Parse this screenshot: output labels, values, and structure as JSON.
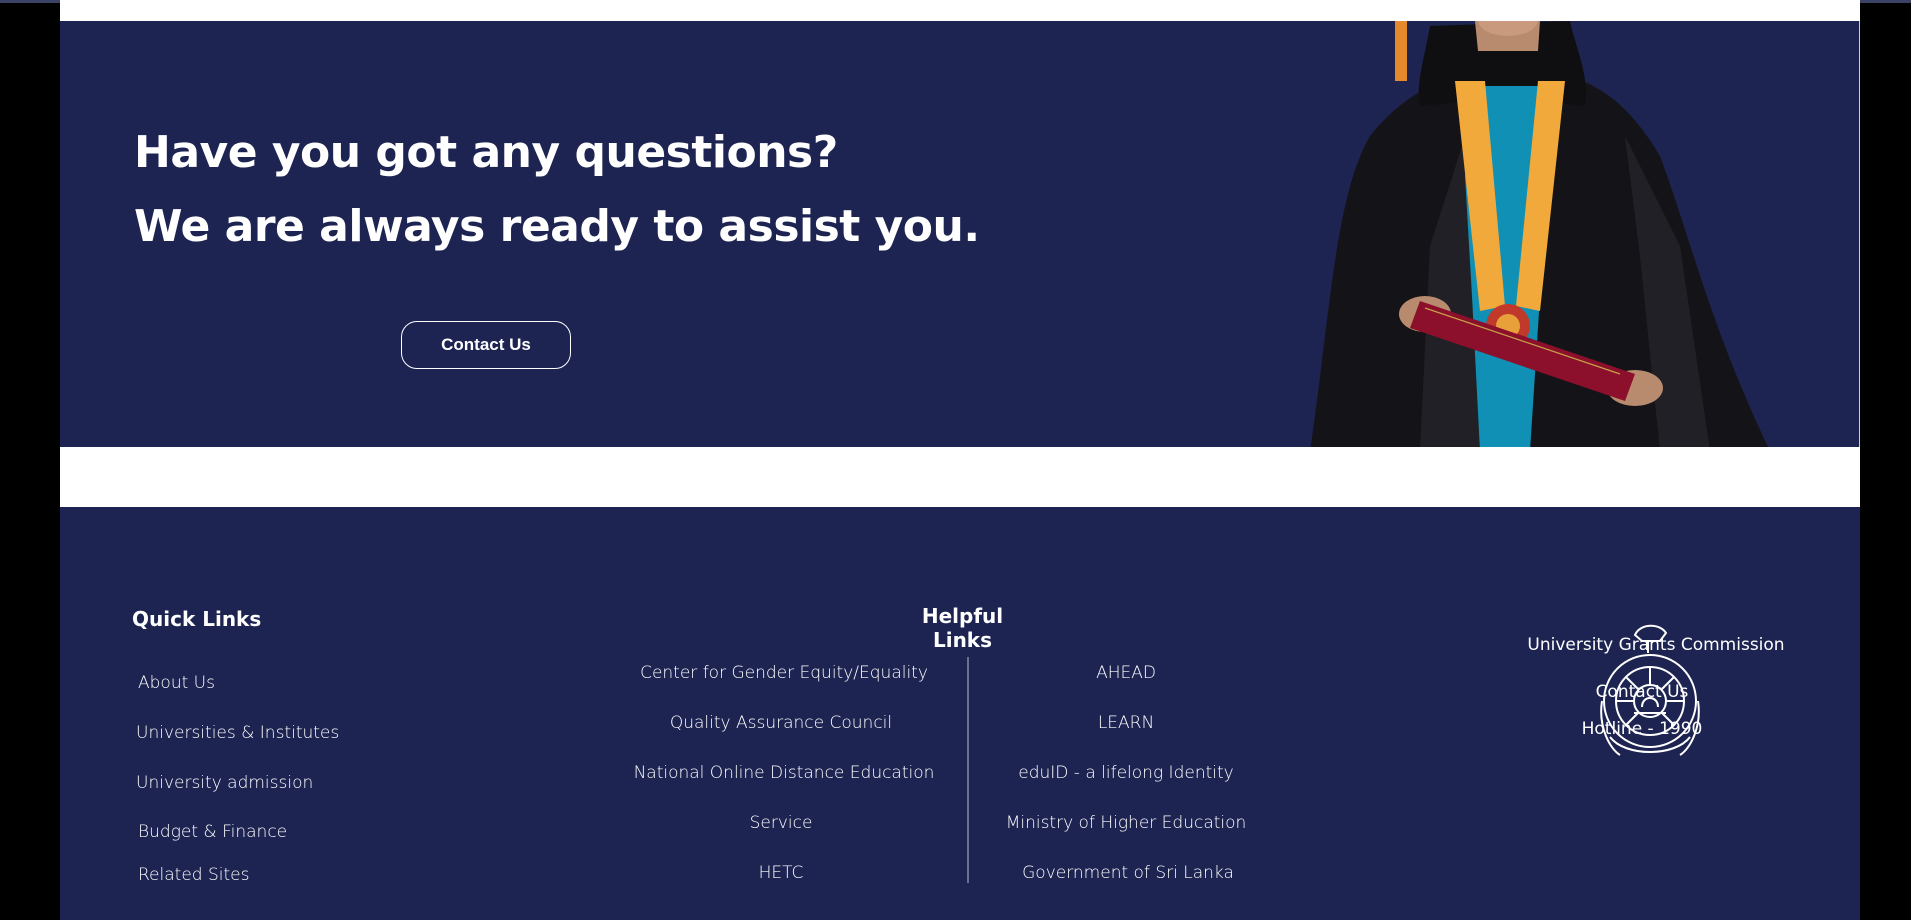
{
  "cta": {
    "heading_line1": "Have you got any questions?",
    "heading_line2": "We are always ready to assist you.",
    "contact_button": "Contact Us"
  },
  "footer": {
    "quick_links": {
      "title": "Quick Links",
      "items": [
        "About Us",
        "Universities & Institutes",
        "University admission",
        "Budget & Finance",
        "Related Sites"
      ]
    },
    "helpful_links": {
      "title": "Helpful Links",
      "left": [
        "Center for Gender Equity/Equality",
        "Quality Assurance Council",
        "National Online Distance Education",
        "Service",
        "HETC"
      ],
      "right": [
        "AHEAD",
        "LEARN",
        "eduID - a lifelong Identity",
        "Ministry of Higher Education",
        "Government of Sri Lanka"
      ]
    },
    "ugc": {
      "name": "University Grants Commission",
      "contact": "Contact Us",
      "hotline": "Hotline - 1990"
    }
  },
  "colors": {
    "navy": "#1d2452",
    "white": "#ffffff",
    "gold": "#f2a93b",
    "teal": "#1190b5",
    "maroon": "#8c0f2b"
  },
  "icons": {
    "emblem": "ugc-emblem-icon"
  }
}
